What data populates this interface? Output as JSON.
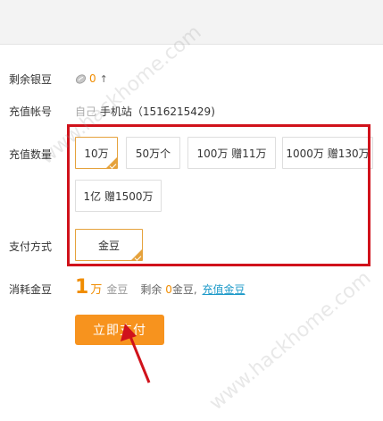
{
  "labels": {
    "balance": "剩余银豆",
    "account": "充值帐号",
    "quantity": "充值数量",
    "payment": "支付方式",
    "consume": "消耗金豆"
  },
  "balance": {
    "count": "0",
    "caret": "↑"
  },
  "account": {
    "prefix": "自己",
    "text": "手机站（1516215429)"
  },
  "quantity_options": [
    {
      "label": "10万",
      "selected": true
    },
    {
      "label": "50万个",
      "selected": false
    },
    {
      "label": "100万 赠11万",
      "selected": false
    },
    {
      "label": "1000万 赠130万",
      "selected": false
    },
    {
      "label": "1亿 赠1500万",
      "selected": false
    }
  ],
  "payment_options": [
    {
      "label": "金豆",
      "selected": true
    }
  ],
  "consume": {
    "amount": "1",
    "unit": "万",
    "currency": "金豆",
    "remain_prefix": "剩余",
    "remain_value": "0",
    "remain_suffix": "金豆,",
    "recharge_link": "充值金豆"
  },
  "pay_button": "立即支付",
  "watermark": "www.hackhome.com",
  "colors": {
    "accent": "#f7931e",
    "highlight": "#d0121b",
    "link": "#1e9ac9"
  }
}
